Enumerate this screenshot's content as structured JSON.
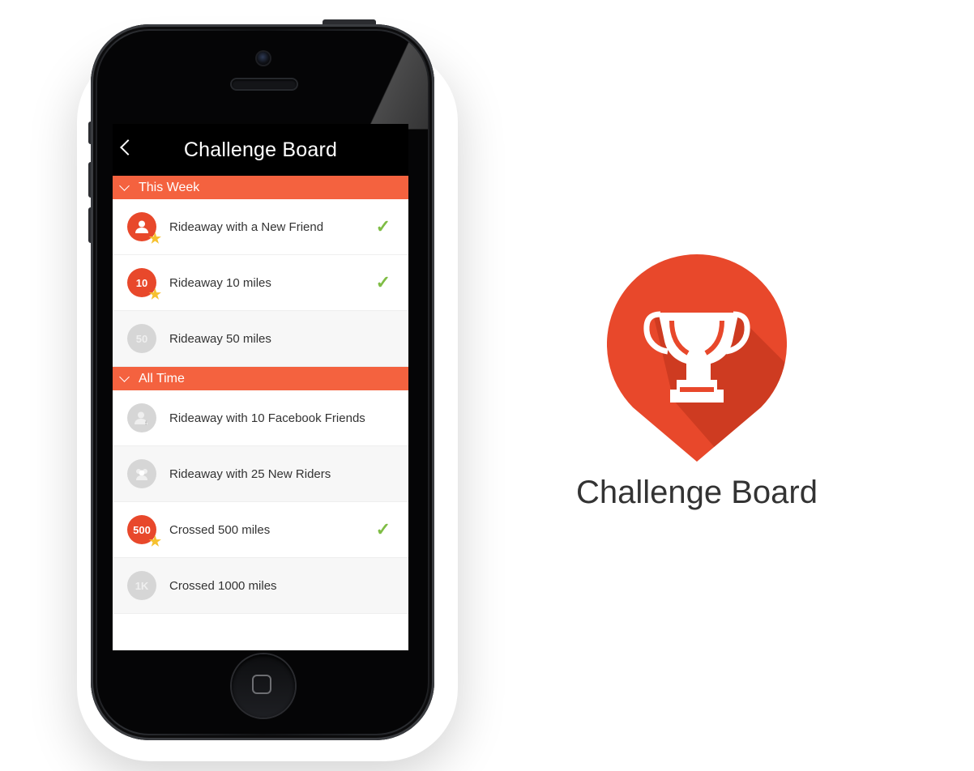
{
  "screen": {
    "title": "Challenge Board",
    "sections": [
      {
        "label": "This Week",
        "items": [
          {
            "label": "Rideaway with a New Friend",
            "badge": "person-icon",
            "badge_text": "",
            "active": true,
            "completed": true
          },
          {
            "label": "Rideaway 10 miles",
            "badge": "number",
            "badge_text": "10",
            "active": true,
            "completed": true
          },
          {
            "label": "Rideaway 50 miles",
            "badge": "number",
            "badge_text": "50",
            "active": false,
            "completed": false
          }
        ]
      },
      {
        "label": "All Time",
        "items": [
          {
            "label": "Rideaway with 10 Facebook Friends",
            "badge": "facebook-person-icon",
            "badge_text": "",
            "active": false,
            "completed": false
          },
          {
            "label": "Rideaway with 25 New Riders",
            "badge": "group-icon",
            "badge_text": "",
            "active": false,
            "completed": false
          },
          {
            "label": "Crossed 500 miles",
            "badge": "number",
            "badge_text": "500",
            "active": true,
            "completed": true
          },
          {
            "label": "Crossed 1000 miles",
            "badge": "number",
            "badge_text": "1K",
            "active": false,
            "completed": false
          }
        ]
      }
    ]
  },
  "logo": {
    "title": "Challenge Board",
    "icon": "trophy-icon"
  },
  "colors": {
    "accent": "#f4623f",
    "badge_active": "#e8482b",
    "badge_inactive": "#d6d6d6",
    "check": "#7fbd45",
    "star": "#f6c12f",
    "logo_pin": "#e8482b"
  }
}
